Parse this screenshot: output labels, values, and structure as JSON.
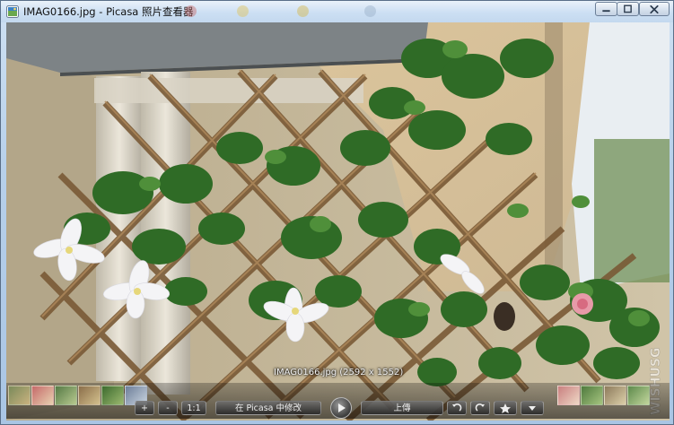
{
  "window": {
    "title": "IMAG0166.jpg - Picasa 照片查看器",
    "controls": [
      "minimize",
      "maximize",
      "close"
    ]
  },
  "photo": {
    "caption": "IMAG0166.jpg (2592 x 1552)",
    "watermark": "WISHUSG"
  },
  "toolbar": {
    "zoom_in_label": "+",
    "zoom_out_label": "-",
    "actual_size_label": "1:1",
    "edit_in_picasa_label": "在 Picasa 中修改",
    "upload_label": "上傳",
    "icons": [
      "play-icon",
      "rotate-left-icon",
      "rotate-right-icon",
      "star-icon",
      "chevron-down-icon"
    ]
  }
}
